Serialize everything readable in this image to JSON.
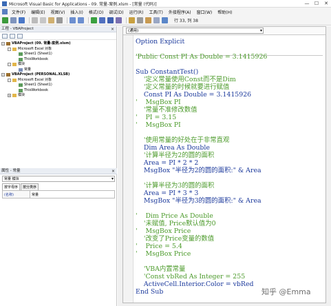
{
  "window": {
    "title": "Microsoft Visual Basic for Applications - 09. 常量-案例.xlsm - [常量 (代码)]",
    "controls": [
      "—",
      "☐",
      "✕"
    ]
  },
  "menu": [
    "文件(F)",
    "编辑(E)",
    "视图(V)",
    "插入(I)",
    "格式(O)",
    "调试(D)",
    "运行(R)",
    "工具(T)",
    "外接程序(A)",
    "窗口(W)",
    "帮助(H)"
  ],
  "toolbar": {
    "position": "行 33, 列 38"
  },
  "project_panel": {
    "title": "工程 - VBAProject",
    "tree": [
      {
        "label": "VBAProject (09. 常量-案例.xlsm)",
        "level": 0,
        "icon": "vba",
        "toggle": "-"
      },
      {
        "label": "Microsoft Excel 对象",
        "level": 1,
        "icon": "folder",
        "toggle": "-"
      },
      {
        "label": "Sheet1 (Sheet1)",
        "level": 2,
        "icon": "sheet",
        "toggle": ""
      },
      {
        "label": "ThisWorkbook",
        "level": 2,
        "icon": "sheet",
        "toggle": ""
      },
      {
        "label": "模块",
        "level": 1,
        "icon": "folder",
        "toggle": "-"
      },
      {
        "label": "常量",
        "level": 2,
        "icon": "mod",
        "toggle": ""
      },
      {
        "label": "VBAProject (PERSONAL.XLSB)",
        "level": 0,
        "icon": "vba",
        "toggle": "-"
      },
      {
        "label": "Microsoft Excel 对象",
        "level": 1,
        "icon": "folder",
        "toggle": "-"
      },
      {
        "label": "Sheet1 (Sheet1)",
        "level": 2,
        "icon": "sheet",
        "toggle": ""
      },
      {
        "label": "ThisWorkbook",
        "level": 2,
        "icon": "sheet",
        "toggle": ""
      },
      {
        "label": "模块",
        "level": 1,
        "icon": "folder",
        "toggle": "+"
      }
    ]
  },
  "properties_panel": {
    "title": "属性 - 常量",
    "object": "常量 模块",
    "tabs": [
      "按字母序",
      "按分类序"
    ],
    "row": {
      "key": "(名称)",
      "value": "常量"
    }
  },
  "code_window": {
    "scope": "(通用)",
    "lines": [
      {
        "text": "Option Explicit",
        "kind": "k",
        "row": 0
      },
      {
        "text": "'Public Const PI As Double = 3.1415926",
        "kind": "c",
        "row": 2
      },
      {
        "text": "Sub ConstantTest()",
        "kind": "k",
        "row": 4
      },
      {
        "text": "    '定义常量使用Const而不是Dim",
        "kind": "c",
        "row": 5
      },
      {
        "text": "    '定义常量的时候就要进行赋值",
        "kind": "c",
        "row": 6
      },
      {
        "text": "    Const PI As Double = 3.1415926",
        "kind": "n",
        "row": 7
      },
      {
        "text": "'    MsgBox PI",
        "kind": "c",
        "row": 8
      },
      {
        "text": "    '常量不准修改数值",
        "kind": "c",
        "row": 9
      },
      {
        "text": "'    PI = 3.15",
        "kind": "c",
        "row": 10
      },
      {
        "text": "'    MsgBox PI",
        "kind": "c",
        "row": 11
      },
      {
        "text": "    '使用常量的好处在于非常直观",
        "kind": "c",
        "row": 13
      },
      {
        "text": "    Dim Area As Double",
        "kind": "n",
        "row": 14
      },
      {
        "text": "    '计算半径为2的圆的面积",
        "kind": "c",
        "row": 15
      },
      {
        "text": "    Area = PI * 2 * 2",
        "kind": "n",
        "row": 16
      },
      {
        "text": "    MsgBox \"半径为2的圆的面积:\" & Area",
        "kind": "n",
        "row": 17
      },
      {
        "text": "    '计算半径为3的圆的面积",
        "kind": "c",
        "row": 19
      },
      {
        "text": "    Area = PI * 3 * 3",
        "kind": "n",
        "row": 20
      },
      {
        "text": "    MsgBox \"半径为3的圆的面积:\" & Area",
        "kind": "n",
        "row": 21
      },
      {
        "text": "'    Dim Price As Double",
        "kind": "c",
        "row": 23
      },
      {
        "text": "    '未赋值, Price默认值为0",
        "kind": "c",
        "row": 24
      },
      {
        "text": "'    MsgBox Price",
        "kind": "c",
        "row": 25
      },
      {
        "text": "    '改变了Price变量的数值",
        "kind": "c",
        "row": 26
      },
      {
        "text": "'    Price = 5.4",
        "kind": "c",
        "row": 27
      },
      {
        "text": "'    MsgBox Price",
        "kind": "c",
        "row": 28
      },
      {
        "text": "    'VBA内置常量",
        "kind": "c",
        "row": 30
      },
      {
        "text": "    'Const vbRed As Integer = 255",
        "kind": "c",
        "row": 31
      },
      {
        "text": "    ActiveCell.Interior.Color = vbRed",
        "kind": "n",
        "row": 32
      },
      {
        "text": "End Sub",
        "kind": "k",
        "row": 33
      }
    ]
  },
  "watermark": "知乎 @Emma"
}
